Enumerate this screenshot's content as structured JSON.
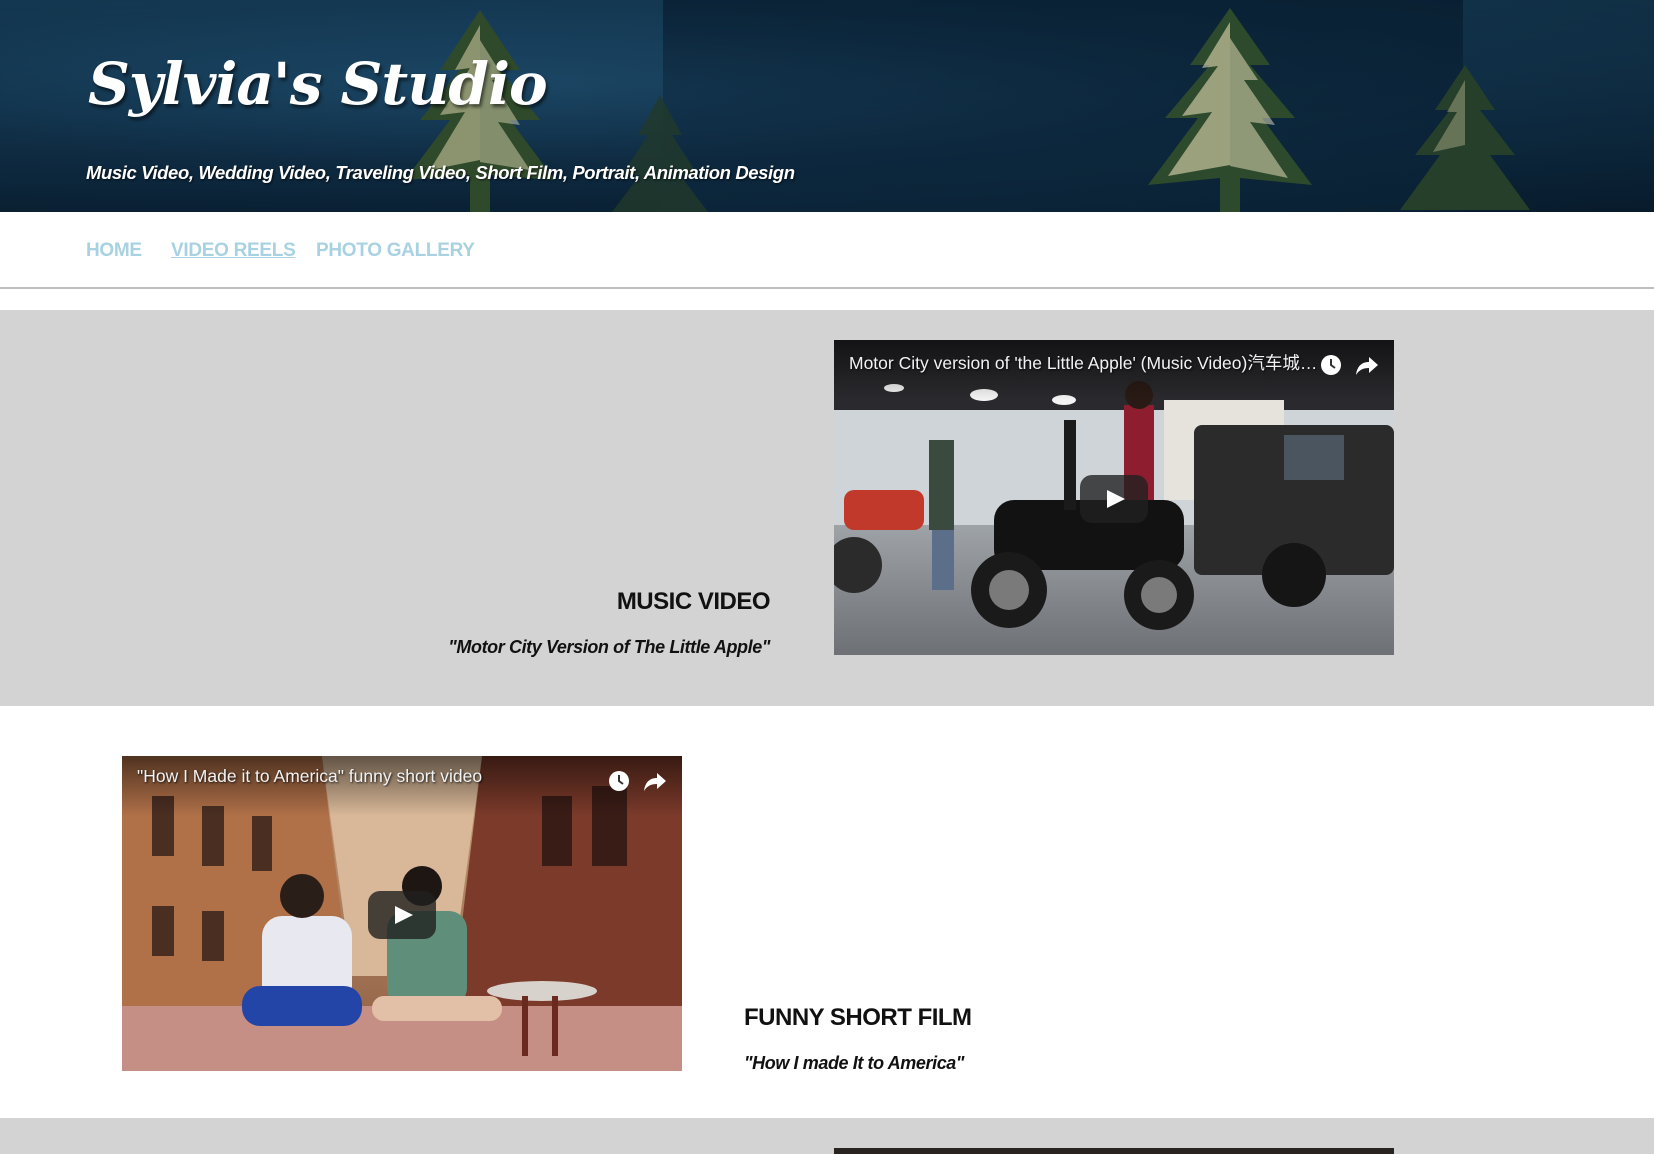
{
  "header": {
    "site_title": "Sylvia's Studio",
    "subtitle": "Music Video, Wedding Video, Traveling Video, Short Film, Portrait, Animation Design"
  },
  "nav": {
    "items": [
      {
        "label": "HOME"
      },
      {
        "label": "VIDEO REELS",
        "active": true
      },
      {
        "label": "PHOTO GALLERY"
      }
    ],
    "link_color": "#a8d2e2"
  },
  "sections": [
    {
      "heading": "MUSIC VIDEO",
      "caption": "\"Motor City Version of The Little Apple\"",
      "video_title": "Motor City version of 'the Little Apple' (Music Video)汽车城版小苹果",
      "background": "#d3d3d3"
    },
    {
      "heading": "FUNNY SHORT FILM",
      "caption": "\"How I made It to America\"",
      "video_title": "\"How I Made it to America\" funny short video",
      "background": "#ffffff"
    }
  ],
  "icons": {
    "watch_later": "clock-icon",
    "share": "share-icon",
    "play": "play-icon"
  }
}
